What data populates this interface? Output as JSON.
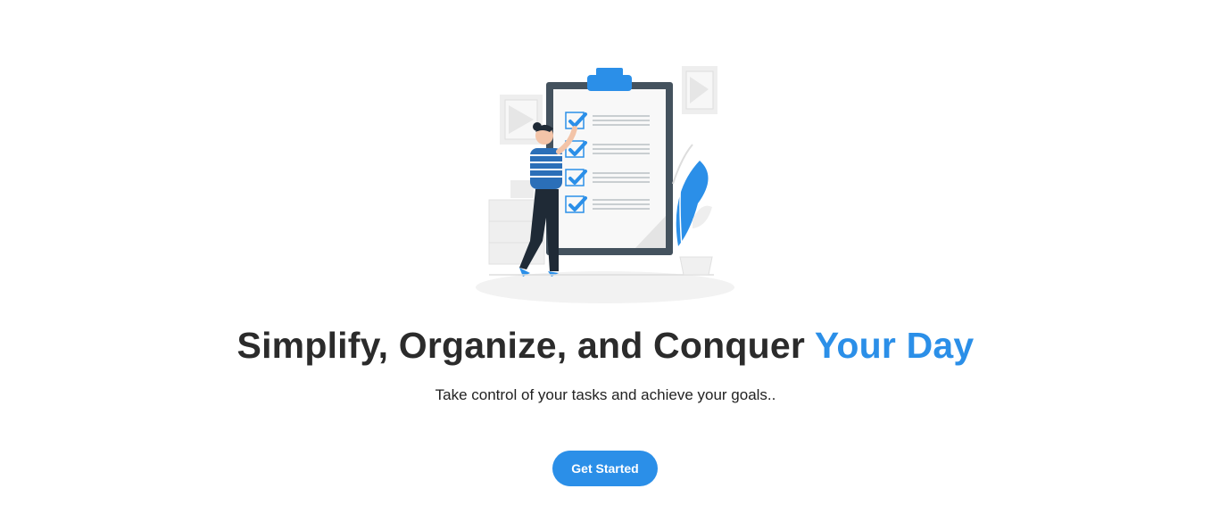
{
  "hero": {
    "headline_main": "Simplify, Organize, and Conquer",
    "headline_accent": "Your Day",
    "subtitle": "Take control of your tasks and achieve your goals..",
    "cta_label": "Get Started",
    "illustration_icon": "checklist-illustration"
  },
  "colors": {
    "accent": "#2b8fe8",
    "heading": "#2b2b2b",
    "background": "#ffffff",
    "clipboard_frame": "#44525e"
  }
}
